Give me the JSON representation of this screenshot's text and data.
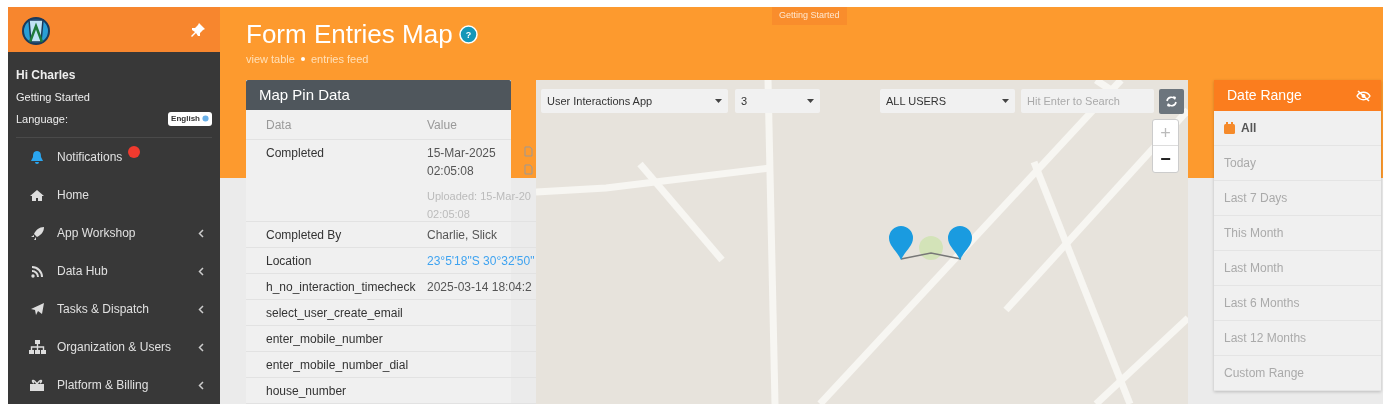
{
  "sidebar": {
    "greeting": "Hi Charles",
    "subtitle": "Getting Started",
    "language_label": "Language:",
    "language_value": "English",
    "menu": [
      {
        "label": "Notifications",
        "alert": true,
        "submenu": false
      },
      {
        "label": "Home",
        "alert": false,
        "submenu": false
      },
      {
        "label": "App Workshop",
        "alert": false,
        "submenu": true
      },
      {
        "label": "Data Hub",
        "alert": false,
        "submenu": true
      },
      {
        "label": "Tasks & Dispatch",
        "alert": false,
        "submenu": true
      },
      {
        "label": "Organization & Users",
        "alert": false,
        "submenu": true
      },
      {
        "label": "Platform & Billing",
        "alert": false,
        "submenu": true
      }
    ]
  },
  "header": {
    "badge": "Getting Started",
    "title": "Form Entries Map",
    "help": "?",
    "links": [
      "view table",
      "entries feed"
    ]
  },
  "pin_data": {
    "title": "Map Pin Data",
    "columns": [
      "Data",
      "Value"
    ],
    "rows": [
      {
        "field": "Completed",
        "value_lines": [
          "15-Mar-2025",
          "02:05:08"
        ],
        "uploaded_lines": [
          "Uploaded: 15-Mar-20",
          "02:05:08"
        ],
        "link": false
      },
      {
        "field": "Completed By",
        "value_lines": [
          "Charlie, Slick"
        ],
        "link": false
      },
      {
        "field": "Location",
        "value_lines": [
          "23°5'18\"S 30°32'50\""
        ],
        "link": true
      },
      {
        "field": "h_no_interaction_timecheck",
        "value_lines": [
          "2025-03-14 18:04:2"
        ],
        "link": false
      },
      {
        "field": "select_user_create_email"
      },
      {
        "field": "enter_mobile_number"
      },
      {
        "field": "enter_mobile_number_dial"
      },
      {
        "field": "house_number"
      }
    ]
  },
  "map": {
    "app_select": "User Interactions App",
    "count_select": "3",
    "users_select": "ALL USERS",
    "search_placeholder": "Hit Enter to Search",
    "zoom_in": "+",
    "zoom_in_disabled": true,
    "zoom_out": "−"
  },
  "date_range": {
    "title": "Date Range",
    "items": [
      {
        "label": "All",
        "selected": true
      },
      {
        "label": "Today",
        "selected": false
      },
      {
        "label": "Last 7 Days",
        "selected": false
      },
      {
        "label": "This Month",
        "selected": false
      },
      {
        "label": "Last Month",
        "selected": false
      },
      {
        "label": "Last 6 Months",
        "selected": false
      },
      {
        "label": "Last 12 Months",
        "selected": false
      },
      {
        "label": "Custom Range",
        "selected": false
      }
    ]
  }
}
